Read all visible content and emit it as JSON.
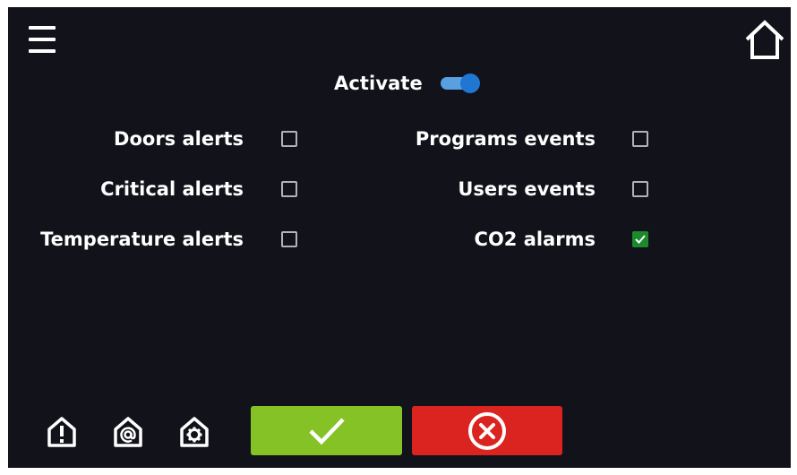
{
  "header": {
    "menu_icon": "hamburger-menu-icon",
    "home_icon": "home-icon"
  },
  "activate": {
    "label": "Activate",
    "enabled": true
  },
  "options": {
    "doors_alerts": {
      "label": "Doors alerts",
      "checked": false
    },
    "critical_alerts": {
      "label": "Critical alerts",
      "checked": false
    },
    "temperature_alerts": {
      "label": "Temperature alerts",
      "checked": false
    },
    "programs_events": {
      "label": "Programs events",
      "checked": false
    },
    "users_events": {
      "label": "Users events",
      "checked": false
    },
    "co2_alarms": {
      "label": "CO2 alarms",
      "checked": true
    }
  },
  "footer": {
    "icons": [
      "alert-icon",
      "email-settings-icon",
      "settings-icon"
    ],
    "confirm_icon": "checkmark-icon",
    "cancel_icon": "cancel-x-icon"
  },
  "colors": {
    "background": "#11121a",
    "toggle_on": "#1f77d2",
    "checkbox_checked": "#1a8a2c",
    "confirm_button": "#84c225",
    "cancel_button": "#db241f"
  }
}
